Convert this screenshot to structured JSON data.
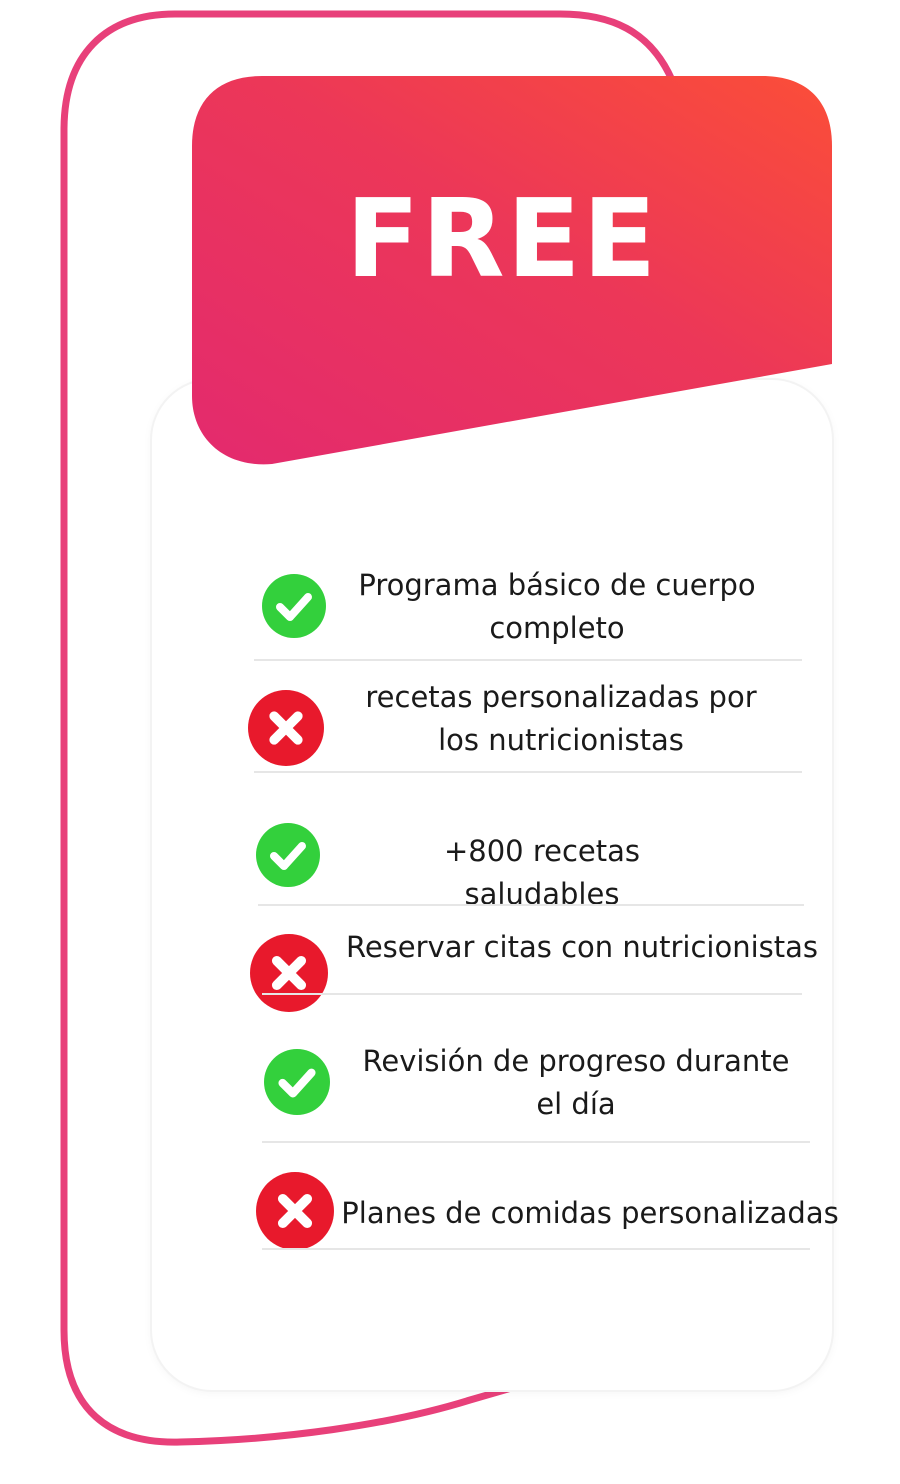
{
  "plan": {
    "title": "FREE",
    "colors": {
      "outline": "#e8407a",
      "banner_start": "#e32a6e",
      "banner_end": "#fb4e38",
      "check": "#33d03c",
      "cross": "#e8192c",
      "text": "#1a1a1a"
    }
  },
  "features": [
    {
      "text": "Programa básico de cuerpo\ncompleto",
      "included": true,
      "icon": "check-icon"
    },
    {
      "text": "recetas  personalizadas por\nlos nutricionistas",
      "included": false,
      "icon": "cross-icon"
    },
    {
      "text": "+800 recetas saludables",
      "included": true,
      "icon": "check-icon"
    },
    {
      "text": "Reservar citas con nutricionistas",
      "included": false,
      "icon": "cross-icon"
    },
    {
      "text": "Revisión de progreso durante\nel día",
      "included": true,
      "icon": "check-icon"
    },
    {
      "text": "Planes de comidas personalizadas",
      "included": false,
      "icon": "cross-icon"
    }
  ]
}
